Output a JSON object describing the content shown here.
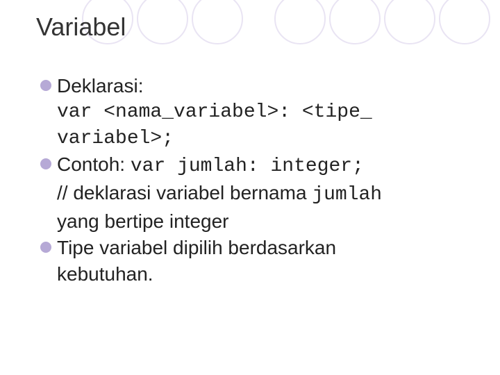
{
  "title": "Variabel",
  "bullets": {
    "b1_label": "Deklarasi:",
    "b1_code_l1": "var <nama_variabel>: <tipe_",
    "b1_code_l2": "variabel>;",
    "b2_label": "Contoh: ",
    "b2_code": "var jumlah: integer;",
    "b2_desc_l1_a": "// deklarasi variabel bernama ",
    "b2_desc_l1_b": "jumlah",
    "b2_desc_l2": "yang bertipe integer",
    "b3_l1": "Tipe variabel dipilih berdasarkan",
    "b3_l2": "kebutuhan."
  }
}
